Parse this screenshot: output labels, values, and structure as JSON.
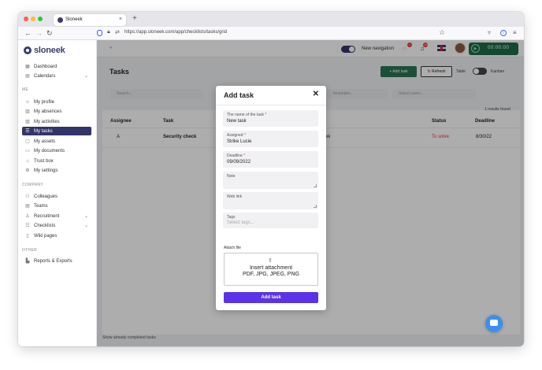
{
  "browser": {
    "tab_title": "Sloneek",
    "tab_close": "×",
    "tab_new": "+",
    "url": "https://app.sloneek.com/app/checklists/tasks/grid",
    "back": "←",
    "forward": "→",
    "reload": "↻",
    "star": "☆"
  },
  "sidebar": {
    "brand": "sloneek",
    "top_items": [
      {
        "label": "Dashboard",
        "icon": "dashboard-icon",
        "glyph": "▦"
      },
      {
        "label": "Calendars",
        "icon": "calendar-icon",
        "glyph": "▤",
        "chevron": "⌄"
      }
    ],
    "me_heading": "ME",
    "me_items": [
      {
        "label": "My profile",
        "glyph": "☺"
      },
      {
        "label": "My absences",
        "glyph": "▥"
      },
      {
        "label": "My activities",
        "glyph": "▧"
      },
      {
        "label": "My tasks",
        "glyph": "☰"
      },
      {
        "label": "My assets",
        "glyph": "▢"
      },
      {
        "label": "My documents",
        "glyph": "▭"
      },
      {
        "label": "Trust box",
        "glyph": "⌂"
      },
      {
        "label": "My settings",
        "glyph": "⚙"
      }
    ],
    "company_heading": "COMPANY",
    "company_items": [
      {
        "label": "Colleagues",
        "glyph": "⚇"
      },
      {
        "label": "Teams",
        "glyph": "▤"
      },
      {
        "label": "Recruitment",
        "glyph": "♙",
        "chevron": "⌄"
      },
      {
        "label": "Checklists",
        "glyph": "☷",
        "chevron": "⌄"
      },
      {
        "label": "Wiki pages",
        "glyph": "▯"
      }
    ],
    "other_heading": "OTHER",
    "other_items": [
      {
        "label": "Reports & Exports",
        "glyph": "▙"
      }
    ]
  },
  "header": {
    "collapse": "«",
    "new_navigation": "New navigation",
    "chat_badge": "1",
    "notif_badge": "10",
    "timer": "00:00:00",
    "play": "▶"
  },
  "page": {
    "title": "Tasks",
    "add_task_btn": "+ Add task",
    "refresh_btn": "↻ Refresh",
    "table_label": "Table",
    "kanban_label": "Kanban",
    "search_placeholder": "Search...",
    "templates_placeholder": "templates...",
    "users_placeholder": "Select users...",
    "results": "1 results found",
    "columns": {
      "assignee": "Assignee",
      "task": "Task",
      "status": "Status",
      "deadline": "Deadline"
    },
    "row": {
      "assignee": "A",
      "task": "Security check",
      "task_tail": "ek",
      "status": "To solve",
      "deadline": "8/30/22"
    },
    "footer": "Show already completed tasks"
  },
  "modal": {
    "title": "Add task",
    "close": "✕",
    "task_name_label": "The name of the task",
    "task_name_value": "New task",
    "assigned_label": "Assigned",
    "assigned_value": "Strike Lucie",
    "deadline_label": "Deadline",
    "deadline_value": "09/09/2022",
    "note_label": "Note",
    "weblink_label": "Web link",
    "tags_label": "Tags",
    "tags_placeholder": "Select tags...",
    "required_mark": "*",
    "attach_label": "Attach file",
    "upload_icon": "⇪",
    "dz_line1": "Insert attachment",
    "dz_line2": "PDF, JPG, JPEG, PNG",
    "submit": "Add task"
  },
  "colors": {
    "brand": "#32346a",
    "submit": "#5a32e8",
    "green": "#2b7355",
    "status_red": "#e53946"
  }
}
